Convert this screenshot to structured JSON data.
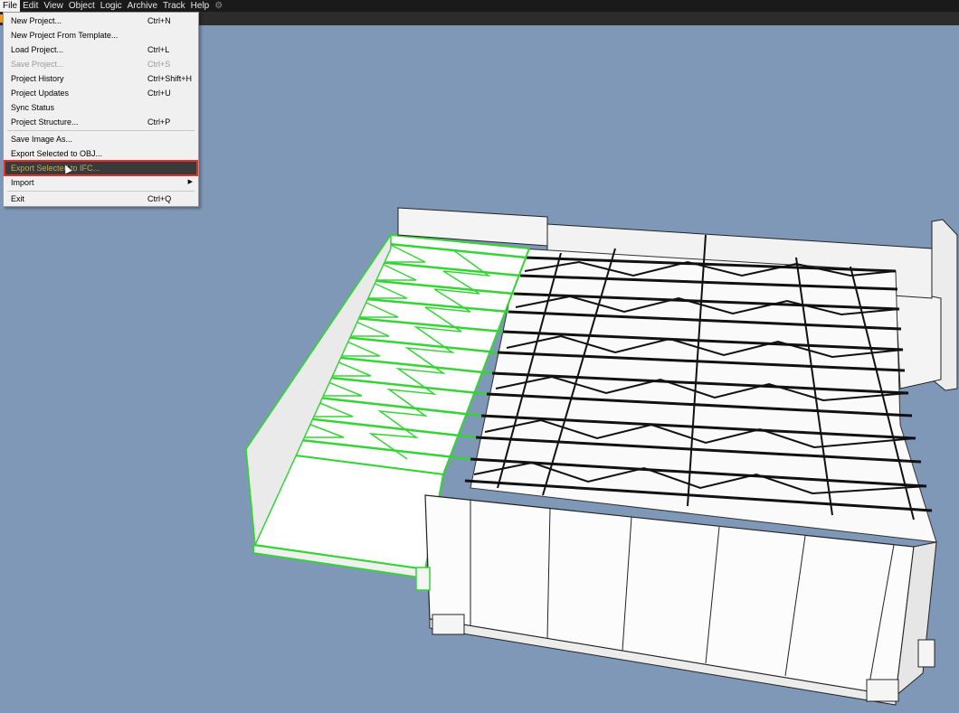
{
  "menubar": {
    "items": [
      {
        "label": "File"
      },
      {
        "label": "Edit"
      },
      {
        "label": "View"
      },
      {
        "label": "Object"
      },
      {
        "label": "Logic"
      },
      {
        "label": "Archive"
      },
      {
        "label": "Track"
      },
      {
        "label": "Help"
      }
    ],
    "extra_icon": "gear-icon"
  },
  "file_menu": {
    "items": [
      {
        "label": "New Project...",
        "shortcut": "Ctrl+N"
      },
      {
        "label": "New Project From Template...",
        "shortcut": ""
      },
      {
        "label": "Load Project...",
        "shortcut": "Ctrl+L"
      },
      {
        "label": "Save Project...",
        "shortcut": "Ctrl+S",
        "disabled": true
      },
      {
        "label": "Project History",
        "shortcut": "Ctrl+Shift+H"
      },
      {
        "label": "Project Updates",
        "shortcut": "Ctrl+U"
      },
      {
        "label": "Sync Status",
        "shortcut": ""
      },
      {
        "label": "Project Structure...",
        "shortcut": "Ctrl+P"
      },
      {
        "label": "Save Image As...",
        "shortcut": ""
      },
      {
        "label": "Export Selected to OBJ...",
        "shortcut": ""
      },
      {
        "label": "Export Selected to IFC...",
        "shortcut": "",
        "highlighted": true
      },
      {
        "label": "Import",
        "shortcut": "",
        "submenu": true
      },
      {
        "label": "Exit",
        "shortcut": "Ctrl+Q"
      }
    ]
  },
  "colors": {
    "viewport_bg": "#7f98b8",
    "selection": "#35d435",
    "menubar_bg": "#1a1a1a",
    "highlight_border": "#e0302a"
  }
}
